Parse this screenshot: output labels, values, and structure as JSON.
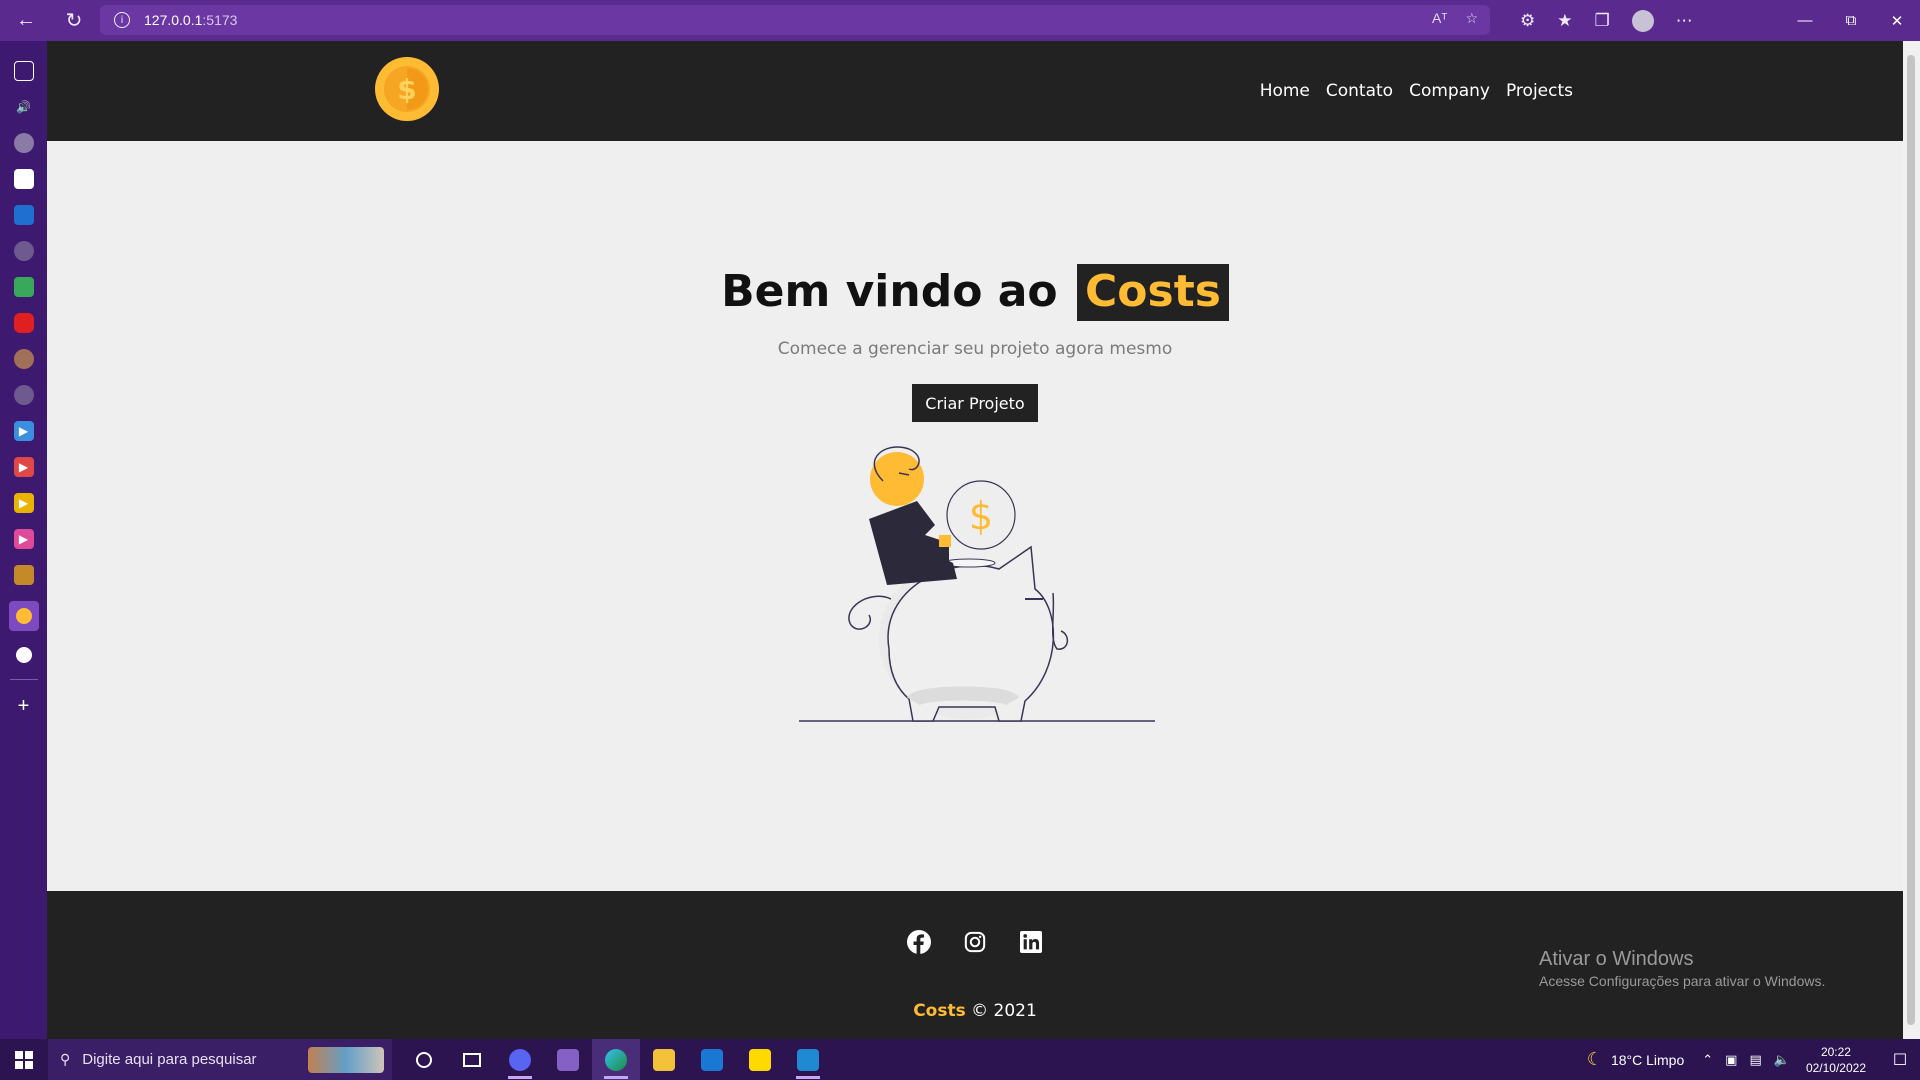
{
  "browser": {
    "url_host": "127.0.0.1",
    "url_port": ":5173",
    "read_aloud": "Aᵀ",
    "window_controls": [
      "—",
      "⧉",
      "✕"
    ]
  },
  "navbar": {
    "logo_alt": "Costs logo",
    "links": [
      "Home",
      "Contato",
      "Company",
      "Projects"
    ]
  },
  "home": {
    "title_prefix": "Bem vindo ao",
    "title_brand": "Costs",
    "subtitle": "Comece a gerenciar seu projeto agora mesmo",
    "cta_label": "Criar Projeto"
  },
  "footer": {
    "social": [
      "facebook-icon",
      "instagram-icon",
      "linkedin-icon"
    ],
    "brand": "Costs",
    "copyright": "© 2021",
    "activate_title": "Ativar o Windows",
    "activate_subtitle": "Acesse Configurações para ativar o Windows."
  },
  "taskbar": {
    "search_placeholder": "Digite aqui para pesquisar",
    "weather": "18°C  Limpo",
    "time": "20:22",
    "date": "02/10/2022"
  },
  "colors": {
    "brand_accent": "#ffbb33",
    "dark": "#222222",
    "page_bg": "#efefef",
    "browser_purple": "#5b2a8f"
  }
}
